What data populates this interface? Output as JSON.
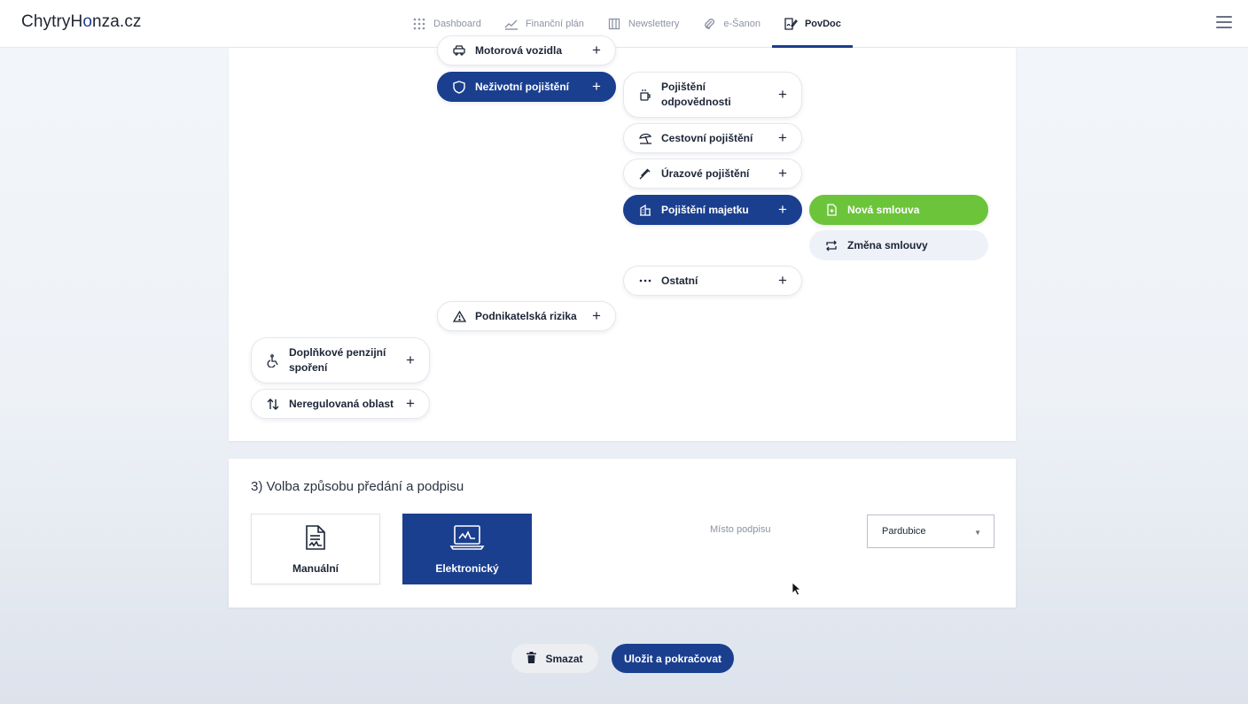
{
  "app": {
    "logo_pre": "Chytry",
    "logo_h": "H",
    "logo_o": "o",
    "logo_post": "nza.cz"
  },
  "nav": {
    "items": [
      {
        "label": "Dashboard",
        "icon": "grid-icon"
      },
      {
        "label": "Finanční plán",
        "icon": "chart-line-icon"
      },
      {
        "label": "Newslettery",
        "icon": "newspaper-icon"
      },
      {
        "label": "e-Šanon",
        "icon": "paperclip-icon"
      },
      {
        "label": "PovDoc",
        "icon": "document-sign-icon",
        "active": true
      }
    ]
  },
  "tree": {
    "motor": "Motorová vozidla",
    "nonlife": "Neživotní pojištění",
    "liability": "Pojištění odpovědnosti",
    "travel": "Cestovní pojištění",
    "accident": "Úrazové pojištění",
    "property": "Pojištění majetku",
    "other": "Ostatní",
    "business": "Podnikatelská rizika",
    "pension": "Doplňkové penzijní spoření",
    "unregulated": "Neregulovaná oblast",
    "new_contract": "Nová smlouva",
    "change_contract": "Změna smlouvy",
    "plus": "+"
  },
  "signing": {
    "title": "3) Volba způsobu předání a podpisu",
    "manual": "Manuální",
    "electronic": "Elektronický",
    "place_label": "Místo podpisu",
    "place_value": "Pardubice"
  },
  "actions": {
    "delete": "Smazat",
    "save": "Uložit a pokračovat"
  },
  "colors": {
    "primary": "#1b3f8f",
    "accent_green": "#6cc43a",
    "pale": "#eef2f8"
  }
}
